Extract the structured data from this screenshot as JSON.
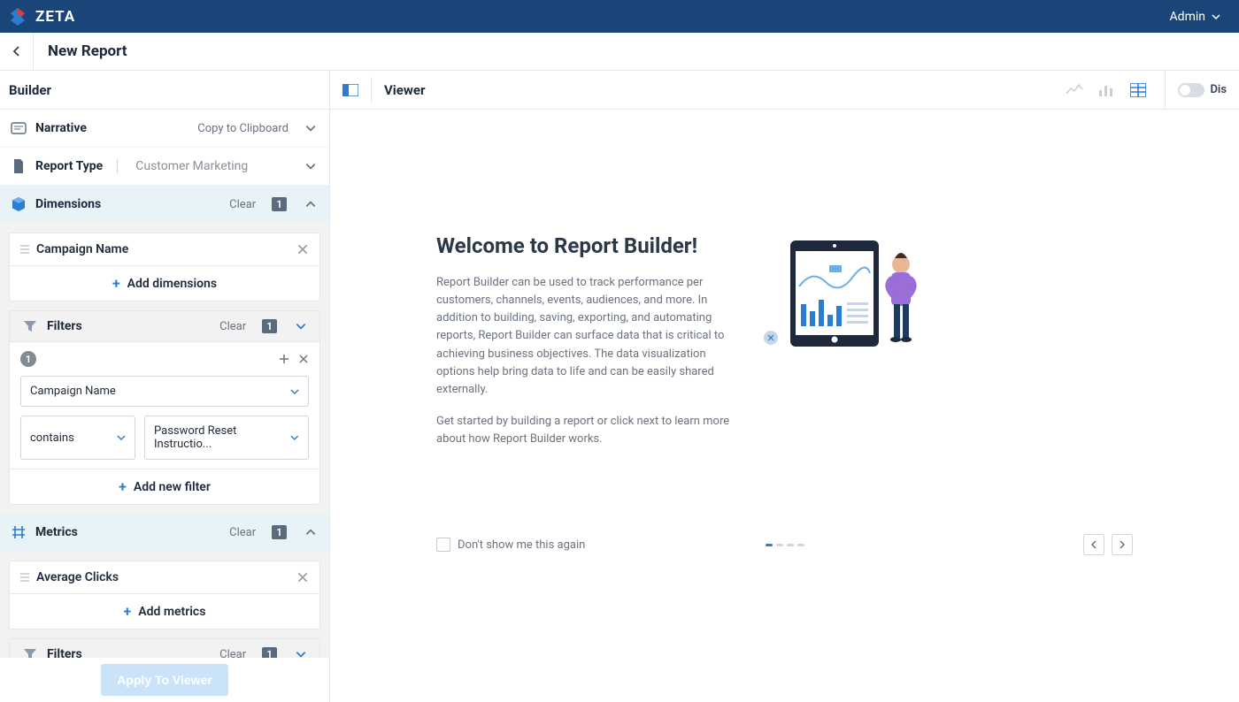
{
  "brand": "ZETA",
  "user_menu": "Admin",
  "page_title": "New Report",
  "sidebar": {
    "header": "Builder",
    "apply_button": "Apply To Viewer",
    "narrative": {
      "label": "Narrative",
      "action": "Copy to Clipboard"
    },
    "report_type": {
      "label": "Report Type",
      "value": "Customer Marketing"
    },
    "dimensions": {
      "label": "Dimensions",
      "clear": "Clear",
      "count": "1",
      "item": "Campaign Name",
      "add": "Add dimensions"
    },
    "dim_filters": {
      "label": "Filters",
      "clear": "Clear",
      "count": "1",
      "group_num": "1",
      "field": "Campaign Name",
      "operator": "contains",
      "value": "Password Reset Instructio...",
      "add": "Add new filter"
    },
    "metrics": {
      "label": "Metrics",
      "clear": "Clear",
      "count": "1",
      "item": "Average Clicks",
      "add": "Add metrics"
    },
    "met_filters": {
      "label": "Filters",
      "clear": "Clear",
      "count": "1"
    }
  },
  "viewer": {
    "header": "Viewer",
    "toggle_label": "Dis",
    "welcome_title": "Welcome to Report Builder!",
    "welcome_p1": "Report Builder can be used to track performance per customers, channels, events, audiences, and more. In addition to building, saving, exporting, and automating reports, Report Builder can surface data that is critical to achieving business objectives. The data visualization options help bring data to life and can be easily shared externally.",
    "welcome_p2": "Get started by building a report or click next to learn more about how Report Builder works.",
    "dont_show": "Don't show me this again"
  }
}
